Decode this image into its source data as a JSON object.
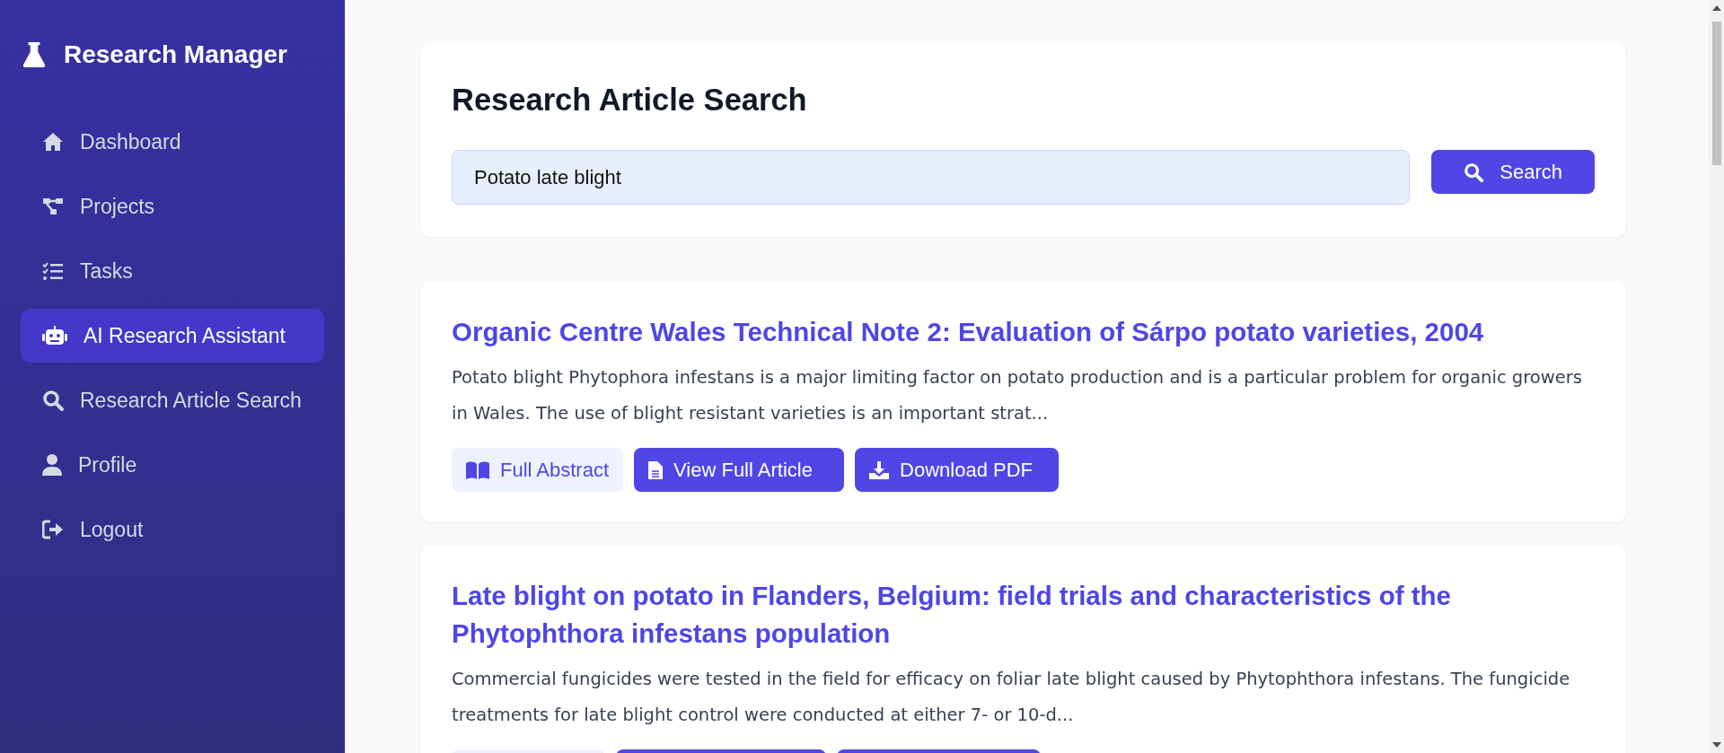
{
  "sidebar": {
    "brand": "Research Manager",
    "items": [
      {
        "label": "Dashboard",
        "kind": "home",
        "selected": false
      },
      {
        "label": "Projects",
        "kind": "projects",
        "selected": false
      },
      {
        "label": "Tasks",
        "kind": "tasks",
        "selected": false
      },
      {
        "label": "AI Research Assistant",
        "kind": "assistant",
        "selected": true
      },
      {
        "label": "Research Article Search",
        "kind": "search",
        "selected": false
      },
      {
        "label": "Profile",
        "kind": "profile",
        "selected": false
      },
      {
        "label": "Logout",
        "kind": "logout",
        "selected": false
      }
    ]
  },
  "search": {
    "title": "Research Article Search",
    "value": "Potato late blight",
    "button": "Search"
  },
  "articles": [
    {
      "title": "Organic Centre Wales Technical Note 2: Evaluation of Sárpo potato varieties, 2004",
      "abstract": "Potato blight Phytophora infestans is a major limiting factor on potato production and is a particular problem for organic growers in Wales. The use of blight resistant varieties is an important strat...",
      "actions": [
        {
          "kind": "abstract",
          "label": "Full Abstract"
        },
        {
          "kind": "view",
          "label": "View Full Article"
        },
        {
          "kind": "download",
          "label": "Download PDF"
        }
      ]
    },
    {
      "title": "Late blight on potato in Flanders, Belgium: field trials and characteristics of the Phytophthora infestans population",
      "abstract": "Commercial fungicides were tested in the field for efficacy on foliar late blight caused by Phytophthora infestans. The fungicide treatments for late blight control were conducted at either 7- or 10-d...",
      "actions": [
        {
          "kind": "abstract"
        },
        {
          "kind": "view"
        },
        {
          "kind": "download"
        }
      ]
    }
  ]
}
